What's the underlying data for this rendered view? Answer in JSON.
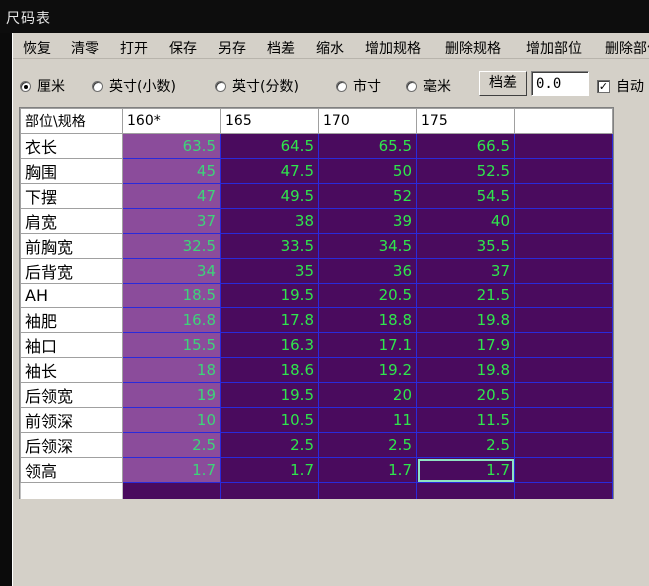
{
  "window": {
    "title": "尺码表"
  },
  "menu": [
    "恢复",
    "清零",
    "打开",
    "保存",
    "另存",
    "档差",
    "缩水",
    "增加规格",
    "删除规格",
    "增加部位",
    "删除部位"
  ],
  "units": {
    "options": [
      "厘米",
      "英寸(小数)",
      "英寸(分数)",
      "市寸",
      "毫米"
    ],
    "selected": "厘米"
  },
  "grade": {
    "button_label": "档差",
    "value": "0.0"
  },
  "auto": {
    "label": "自动",
    "checked": true
  },
  "table": {
    "corner": "部位\\规格",
    "columns": [
      "160*",
      "165",
      "170",
      "175"
    ],
    "selected_cell": {
      "row": "领高",
      "column": "175"
    },
    "rows": [
      {
        "part": "衣长",
        "values": [
          "63.5",
          "64.5",
          "65.5",
          "66.5"
        ]
      },
      {
        "part": "胸围",
        "values": [
          "45",
          "47.5",
          "50",
          "52.5"
        ]
      },
      {
        "part": "下摆",
        "values": [
          "47",
          "49.5",
          "52",
          "54.5"
        ]
      },
      {
        "part": "肩宽",
        "values": [
          "37",
          "38",
          "39",
          "40"
        ]
      },
      {
        "part": "前胸宽",
        "values": [
          "32.5",
          "33.5",
          "34.5",
          "35.5"
        ]
      },
      {
        "part": "后背宽",
        "values": [
          "34",
          "35",
          "36",
          "37"
        ]
      },
      {
        "part": "AH",
        "values": [
          "18.5",
          "19.5",
          "20.5",
          "21.5"
        ]
      },
      {
        "part": "袖肥",
        "values": [
          "16.8",
          "17.8",
          "18.8",
          "19.8"
        ]
      },
      {
        "part": "袖口",
        "values": [
          "15.5",
          "16.3",
          "17.1",
          "17.9"
        ]
      },
      {
        "part": "袖长",
        "values": [
          "18",
          "18.6",
          "19.2",
          "19.8"
        ]
      },
      {
        "part": "后领宽",
        "values": [
          "19",
          "19.5",
          "20",
          "20.5"
        ]
      },
      {
        "part": "前领深",
        "values": [
          "10",
          "10.5",
          "11",
          "11.5"
        ]
      },
      {
        "part": "后领深",
        "values": [
          "2.5",
          "2.5",
          "2.5",
          "2.5"
        ]
      },
      {
        "part": "领高",
        "values": [
          "1.7",
          "1.7",
          "1.7",
          "1.7"
        ]
      }
    ]
  }
}
